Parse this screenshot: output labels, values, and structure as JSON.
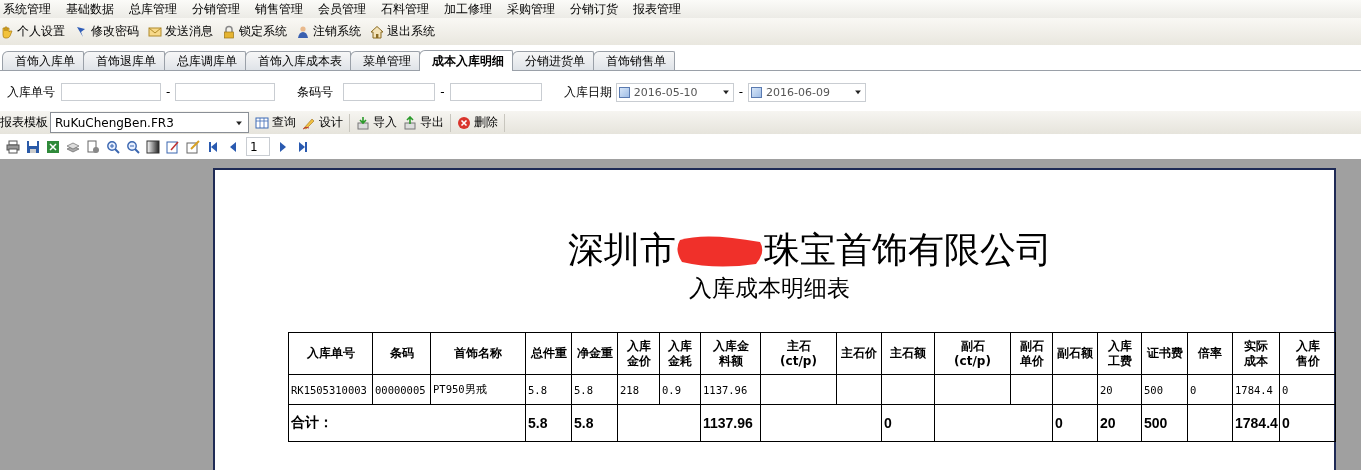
{
  "menu_bar": [
    "系统管理",
    "基础数据",
    "总库管理",
    "分销管理",
    "销售管理",
    "会员管理",
    "石料管理",
    "加工修理",
    "采购管理",
    "分销订货",
    "报表管理"
  ],
  "toolbar": [
    "个人设置",
    "修改密码",
    "发送消息",
    "锁定系统",
    "注销系统",
    "退出系统"
  ],
  "tabs": [
    {
      "label": "首饰入库单",
      "selected": false
    },
    {
      "label": "首饰退库单",
      "selected": false
    },
    {
      "label": "总库调库单",
      "selected": false
    },
    {
      "label": "首饰入库成本表",
      "selected": false
    },
    {
      "label": "菜单管理",
      "selected": false
    },
    {
      "label": "成本入库明细",
      "selected": true
    },
    {
      "label": "分销进货单",
      "selected": false
    },
    {
      "label": "首饰销售单",
      "selected": false
    }
  ],
  "filters": {
    "order_no_label": "入库单号",
    "barcode_label": "条码号",
    "date_label": "入库日期",
    "separator": "-",
    "date_from": {
      "value": "2016-05-10",
      "checked": false
    },
    "date_to": {
      "value": "2016-06-09",
      "checked": false
    }
  },
  "report_bar": {
    "template_label": "报表模板",
    "template": "RuKuChengBen.FR3",
    "buttons": [
      "查询",
      "设计",
      "导入",
      "导出",
      "删除"
    ]
  },
  "preview_toolbar": {
    "page": "1"
  },
  "report": {
    "title_before": "深圳市",
    "title_after": "珠宝首饰有限公司",
    "subtitle": "入库成本明细表",
    "table": {
      "columns": [
        "入库单号",
        "条码",
        "首饰名称",
        "总件重",
        "净金重",
        "入库金价",
        "入库金耗",
        "入库金料额",
        "主石 (ct/p)",
        "主石价",
        "主石额",
        "副石 (ct/p)",
        "副石单价",
        "副石额",
        "入库工费",
        "证书费",
        "倍率",
        "实际成本",
        "入库售价"
      ],
      "rows": [
        [
          "RK1505310003",
          "00000005",
          "PT950男戒",
          "5.8",
          "5.8",
          "218",
          "0.9",
          "1137.96",
          null,
          null,
          null,
          null,
          null,
          null,
          "20",
          "500",
          "0",
          "1784.4",
          "0"
        ]
      ],
      "totals": [
        {
          "kind": "value",
          "text": "合计："
        },
        {
          "kind": "value",
          "text": "5.8"
        },
        {
          "kind": "value",
          "text": "5.8"
        },
        {
          "kind": "blank"
        },
        {
          "kind": "value",
          "text": "1137.96"
        },
        {
          "kind": "blank"
        },
        {
          "kind": "value",
          "text": "0"
        },
        {
          "kind": "blank"
        },
        {
          "kind": "value",
          "text": "0"
        },
        {
          "kind": "value",
          "text": "20"
        },
        {
          "kind": "value",
          "text": "500"
        },
        {
          "kind": "blank"
        },
        {
          "kind": "value",
          "text": "1784.4"
        },
        {
          "kind": "value",
          "text": "0"
        }
      ]
    }
  }
}
